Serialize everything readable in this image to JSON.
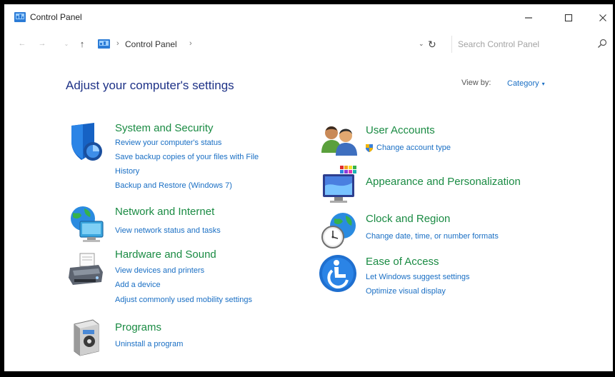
{
  "window": {
    "title": "Control Panel",
    "controls": {
      "minimize": "–",
      "maximize": "☐",
      "close": "✕"
    }
  },
  "address": {
    "back": "←",
    "forward": "→",
    "recent": "⌄",
    "up": "↑",
    "separator1": "›",
    "crumb": "Control Panel",
    "separator2": "›",
    "dropdown": "⌄",
    "refresh": "↻",
    "search_placeholder": "Search Control Panel"
  },
  "content": {
    "heading": "Adjust your computer's settings",
    "view_by_label": "View by:",
    "view_by_value": "Category",
    "view_by_caret": "▾"
  },
  "categories": {
    "system": {
      "title": "System and Security",
      "links": [
        "Review your computer's status",
        "Save backup copies of your files with File",
        "History",
        "Backup and Restore (Windows 7)"
      ]
    },
    "network": {
      "title": "Network and Internet",
      "links": [
        "View network status and tasks"
      ]
    },
    "hardware": {
      "title": "Hardware and Sound",
      "links": [
        "View devices and printers",
        "Add a device",
        "Adjust commonly used mobility settings"
      ]
    },
    "programs": {
      "title": "Programs",
      "links": [
        "Uninstall a program"
      ]
    },
    "users": {
      "title": "User Accounts",
      "links": [
        "Change account type"
      ]
    },
    "appearance": {
      "title": "Appearance and Personalization",
      "links": []
    },
    "clock": {
      "title": "Clock and Region",
      "links": [
        "Change date, time, or number formats"
      ]
    },
    "ease": {
      "title": "Ease of Access",
      "links": [
        "Let Windows suggest settings",
        "Optimize visual display"
      ]
    }
  },
  "colors": {
    "heading": "#1e3287",
    "category_title": "#1a8b43",
    "link": "#1a6fc4"
  },
  "icons": [
    "control-panel-icon",
    "shield-icon",
    "network-globe-icon",
    "printer-icon",
    "programs-box-icon",
    "users-icon",
    "uac-shield-icon",
    "monitor-palette-icon",
    "clock-globe-icon",
    "accessibility-icon",
    "search-icon"
  ]
}
